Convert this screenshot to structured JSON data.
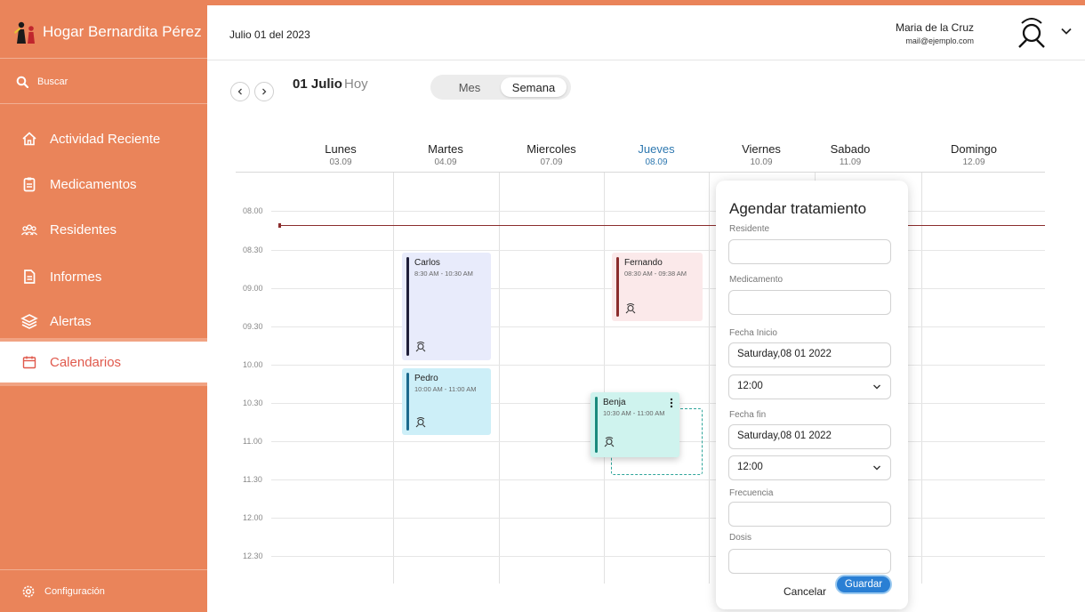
{
  "app": {
    "name": "Hogar Bernardita Pérez"
  },
  "colors": {
    "sidebar": "#ea845a",
    "accent": "#2a7fd4",
    "now_line": "#8b2d2d",
    "today": "#2e78b0"
  },
  "sidebar": {
    "search_label": "Buscar",
    "items": [
      {
        "label": "Actividad Reciente",
        "icon": "home-icon"
      },
      {
        "label": "Medicamentos",
        "icon": "clipboard-icon"
      },
      {
        "label": "Residentes",
        "icon": "people-icon"
      },
      {
        "label": "Informes",
        "icon": "document-icon"
      },
      {
        "label": "Alertas",
        "icon": "layers-icon"
      },
      {
        "label": "Calendarios",
        "icon": "calendar-icon",
        "active": true
      }
    ],
    "config_label": "Configuración"
  },
  "header": {
    "date": "Julio 01 del 2023",
    "user_name": "Maria de la Cruz",
    "user_email": "mail@ejemplo.com"
  },
  "toolbar": {
    "current_date": "01 Julio",
    "today_label": "Hoy",
    "view_month": "Mes",
    "view_week": "Semana",
    "active_view": "Semana"
  },
  "calendar": {
    "days": [
      {
        "name": "Lunes",
        "date": "03.09"
      },
      {
        "name": "Martes",
        "date": "04.09"
      },
      {
        "name": "Miercoles",
        "date": "07.09"
      },
      {
        "name": "Jueves",
        "date": "08.09",
        "today": true
      },
      {
        "name": "Viernes",
        "date": "10.09"
      },
      {
        "name": "Sabado",
        "date": "11.09"
      },
      {
        "name": "Domingo",
        "date": "12.09"
      }
    ],
    "times": [
      "08.00",
      "08.30",
      "09.00",
      "09.30",
      "10.00",
      "10.30",
      "11.00",
      "11.30",
      "12.00",
      "12.30"
    ],
    "events": [
      {
        "name": "Carlos",
        "time": "8:30 AM - 10:30 AM"
      },
      {
        "name": "Fernando",
        "time": "08:30 AM - 09:38 AM"
      },
      {
        "name": "Pedro",
        "time": "10:00 AM - 11:00 AM"
      },
      {
        "name": "Benja",
        "time": "10:30 AM - 11:00 AM"
      }
    ]
  },
  "panel": {
    "title": "Agendar tratamiento",
    "resident_label": "Residente",
    "resident_value": "",
    "medication_label": "Medicamento",
    "medication_value": "",
    "start_label": "Fecha Inicio",
    "start_date": "Saturday,08 01 2022",
    "start_time": "12:00",
    "end_label": "Fecha fin",
    "end_date": "Saturday,08 01 2022",
    "end_time": "12:00",
    "frequency_label": "Frecuencia",
    "frequency_value": "",
    "dose_label": "Dosis",
    "dose_value": "",
    "cancel": "Cancelar",
    "save": "Guardar"
  }
}
